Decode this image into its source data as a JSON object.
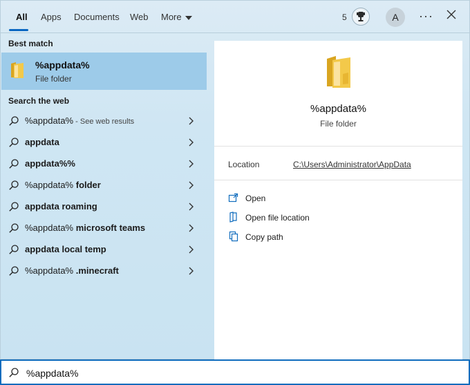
{
  "tabs": [
    {
      "label": "All",
      "active": true
    },
    {
      "label": "Apps"
    },
    {
      "label": "Documents"
    },
    {
      "label": "Web"
    },
    {
      "label": "More"
    }
  ],
  "header": {
    "points": "5",
    "avatar_initial": "A",
    "more_glyph": "···",
    "icons": [
      "trophy-icon",
      "more-options-icon",
      "close-icon"
    ]
  },
  "best_match": {
    "section_title": "Best match",
    "title": "%appdata%",
    "subtitle": "File folder",
    "icon": "folder-icon"
  },
  "web": {
    "section_title": "Search the web",
    "items": [
      {
        "prefix": "%appdata%",
        "bold": "",
        "hint": " - See web results"
      },
      {
        "prefix": "",
        "bold": "appdata",
        "hint": ""
      },
      {
        "prefix": "",
        "bold": "appdata%%",
        "hint": ""
      },
      {
        "prefix": "%appdata%",
        "bold": " folder",
        "hint": ""
      },
      {
        "prefix": "",
        "bold": "appdata roaming",
        "hint": ""
      },
      {
        "prefix": "%appdata%",
        "bold": " microsoft teams",
        "hint": ""
      },
      {
        "prefix": "",
        "bold": "appdata local temp",
        "hint": ""
      },
      {
        "prefix": "%appdata%",
        "bold": " .minecraft",
        "hint": ""
      }
    ]
  },
  "preview": {
    "title": "%appdata%",
    "subtitle": "File folder",
    "location_label": "Location",
    "location_value": "C:\\Users\\Administrator\\AppData",
    "actions": [
      {
        "label": "Open",
        "icon": "open-icon"
      },
      {
        "label": "Open file location",
        "icon": "file-location-icon"
      },
      {
        "label": "Copy path",
        "icon": "copy-path-icon"
      }
    ]
  },
  "search": {
    "value": "%appdata%",
    "icon": "search-icon"
  },
  "colors": {
    "accent": "#0f6cbd",
    "selected_row": "#9dcbe9",
    "panel_bg": "#cfe6f3",
    "folder": "#f2c94c"
  }
}
